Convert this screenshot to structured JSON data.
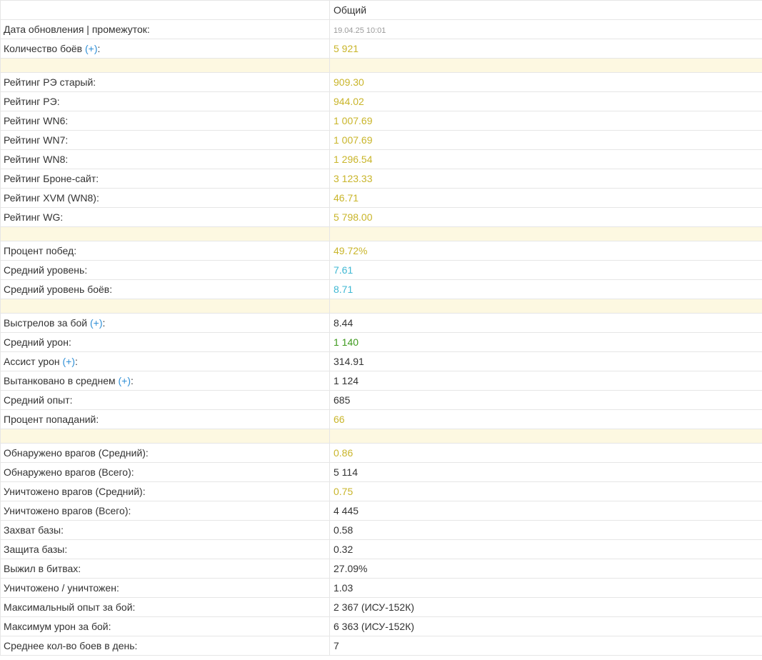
{
  "header": {
    "column_label": "",
    "column_value": "Общий"
  },
  "intro": {
    "update": {
      "label": "Дата обновления | промежуток:",
      "value": "19.04.25 10:01"
    },
    "battles": {
      "label": "Количество боёв",
      "plus": "(+)",
      "suffix": ":",
      "value": "5 921"
    }
  },
  "ratings": [
    {
      "label": "Рейтинг РЭ старый:",
      "value": "909.30"
    },
    {
      "label": "Рейтинг РЭ:",
      "value": "944.02"
    },
    {
      "label": "Рейтинг WN6:",
      "value": "1 007.69"
    },
    {
      "label": "Рейтинг WN7:",
      "value": "1 007.69"
    },
    {
      "label": "Рейтинг WN8:",
      "value": "1 296.54"
    },
    {
      "label": "Рейтинг Броне-сайт:",
      "value": "3 123.33"
    },
    {
      "label": "Рейтинг XVM (WN8):",
      "value": "46.71"
    },
    {
      "label": "Рейтинг WG:",
      "value": "5 798.00"
    }
  ],
  "general": [
    {
      "label": "Процент побед:",
      "value": "49.72%"
    },
    {
      "label": "Средний уровень:",
      "value": "7.61"
    },
    {
      "label": "Средний уровень боёв:",
      "value": "8.71"
    }
  ],
  "combat": [
    {
      "label": "Выстрелов за бой",
      "plus": "(+)",
      "suffix": ":",
      "value": "8.44"
    },
    {
      "label": "Средний урон:",
      "value": "1 140"
    },
    {
      "label": "Ассист урон",
      "plus": "(+)",
      "suffix": ":",
      "value": "314.91"
    },
    {
      "label": "Вытанковано в среднем",
      "plus": "(+)",
      "suffix": ":",
      "value": "1 124"
    },
    {
      "label": "Средний опыт:",
      "value": "685"
    },
    {
      "label": "Процент попаданий:",
      "value": "66"
    }
  ],
  "enemies": [
    {
      "label": "Обнаружено врагов (Средний):",
      "value": "0.86"
    },
    {
      "label": "Обнаружено врагов (Всего):",
      "value": "5 114"
    },
    {
      "label": "Уничтожено врагов (Средний):",
      "value": "0.75"
    },
    {
      "label": "Уничтожено врагов (Всего):",
      "value": "4 445"
    },
    {
      "label": "Захват базы:",
      "value": "0.58"
    },
    {
      "label": "Защита базы:",
      "value": "0.32"
    },
    {
      "label": "Выжил в битвах:",
      "value": "27.09%"
    },
    {
      "label": "Уничтожено / уничтожен:",
      "value": "1.03"
    },
    {
      "label": "Максимальный опыт за бой:",
      "value": "2 367 (ИСУ-152К)"
    },
    {
      "label": "Максимум урон за бой:",
      "value": "6 363 (ИСУ-152К)"
    },
    {
      "label": "Среднее кол-во боев в день:",
      "value": "7"
    }
  ],
  "colors": {
    "yellow": "#c9b52a",
    "cyan": "#3fb8d3",
    "green": "#3e9a1e",
    "link": "#2f8fd6",
    "spacer": "#fdf8e1",
    "border": "#e6e6e6"
  }
}
